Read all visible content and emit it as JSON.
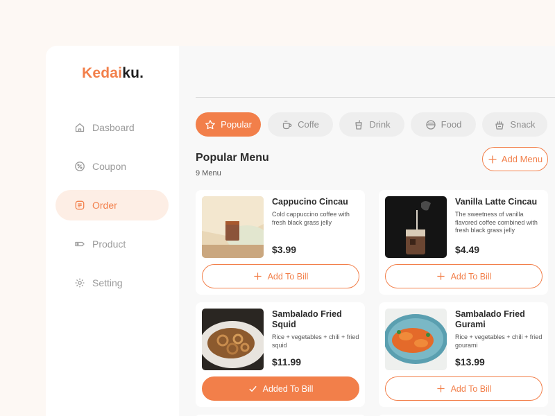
{
  "brand": {
    "part1": "Kedai",
    "part2": "ku."
  },
  "colors": {
    "accent": "#f27f4a",
    "accent_soft": "#fdeee5",
    "background": "#fdf8f4"
  },
  "sidebar": {
    "items": [
      {
        "label": "Dasboard",
        "icon": "home-icon",
        "active": false
      },
      {
        "label": "Coupon",
        "icon": "percent-icon",
        "active": false
      },
      {
        "label": "Order",
        "icon": "order-list-icon",
        "active": true
      },
      {
        "label": "Product",
        "icon": "tag-icon",
        "active": false
      },
      {
        "label": "Setting",
        "icon": "gear-icon",
        "active": false
      }
    ]
  },
  "categories": [
    {
      "label": "Popular",
      "icon": "star-icon",
      "active": true
    },
    {
      "label": "Coffe",
      "icon": "coffee-cup-icon",
      "active": false
    },
    {
      "label": "Drink",
      "icon": "drink-cup-icon",
      "active": false
    },
    {
      "label": "Food",
      "icon": "bowl-icon",
      "active": false
    },
    {
      "label": "Snack",
      "icon": "snack-basket-icon",
      "active": false
    }
  ],
  "menu": {
    "title": "Popular Menu",
    "count": "9 Menu",
    "add_label": "Add Menu",
    "items": [
      {
        "name": "Cappucino Cincau",
        "desc": "Cold cappuccino coffee with fresh black grass jelly",
        "price": "$3.99",
        "button": "Add To Bill",
        "added": false
      },
      {
        "name": "Vanilla Latte Cincau",
        "desc": "The sweetness of vanilla flavored coffee combined with fresh black grass jelly",
        "price": "$4.49",
        "button": "Add To Bill",
        "added": false
      },
      {
        "name": "Sambalado Fried Squid",
        "desc": "Rice + vegetables + chili + fried squid",
        "price": "$11.99",
        "button": "Added To Bill",
        "added": true
      },
      {
        "name": "Sambalado Fried Gurami",
        "desc": "Rice + vegetables + chili + fried gourami",
        "price": "$13.99",
        "button": "Add To Bill",
        "added": false
      }
    ]
  }
}
